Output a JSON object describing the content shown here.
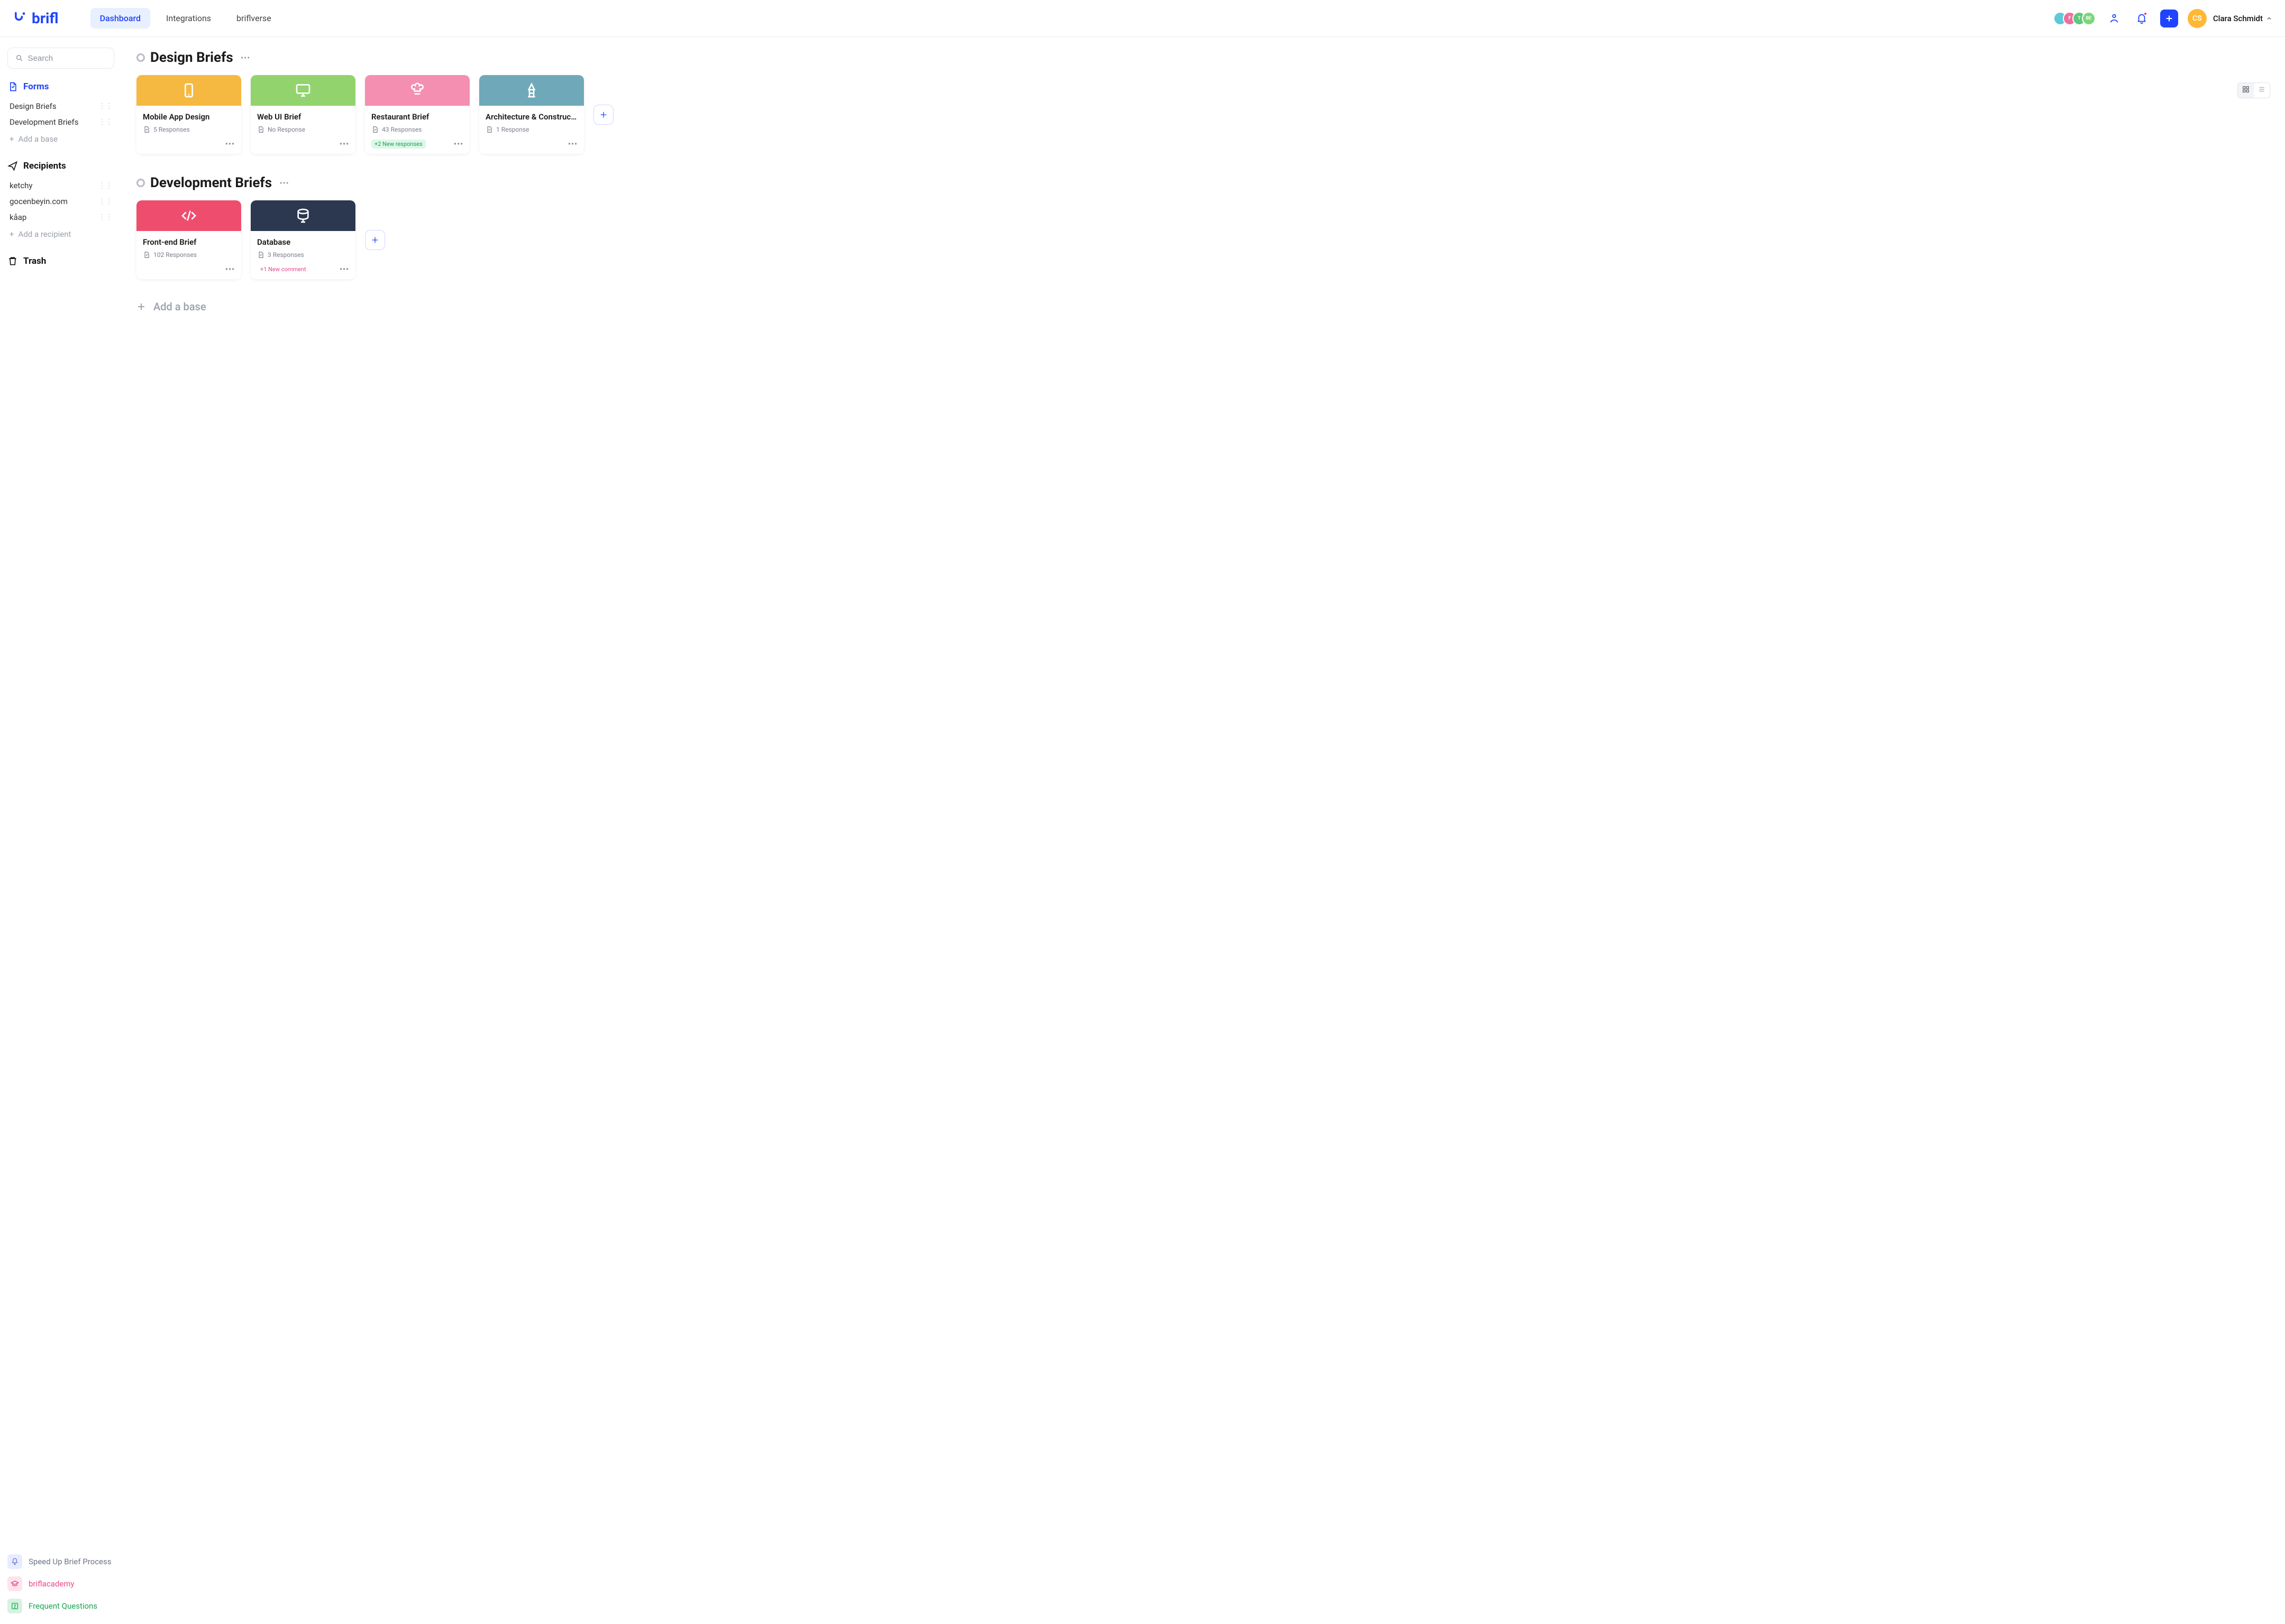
{
  "brand": "brifl",
  "nav": {
    "tabs": [
      "Dashboard",
      "Integrations",
      "briflverse"
    ],
    "active": 0
  },
  "header_avatars": [
    "",
    "F",
    "T",
    "BE"
  ],
  "user": {
    "initials": "CS",
    "name": "Clara Schmidt"
  },
  "search_placeholder": "Search",
  "sidebar": {
    "forms": {
      "title": "Forms",
      "items": [
        "Design Briefs",
        "Development Briefs"
      ],
      "add_label": "Add a base"
    },
    "recipients": {
      "title": "Recipients",
      "items": [
        "ketchy",
        "gocenbeyin.com",
        "kåap"
      ],
      "add_label": "Add a recipient"
    },
    "trash": "Trash",
    "footer": {
      "speed": "Speed Up Brief Process",
      "academy": "briflacademy",
      "faq": "Frequent Questions"
    }
  },
  "sections": [
    {
      "title": "Design Briefs",
      "cards": [
        {
          "title": "Mobile App Design",
          "meta": "5 Responses",
          "color": "c-yellow",
          "icon": "tablet",
          "badge": null,
          "badge_class": ""
        },
        {
          "title": "Web UI Brief",
          "meta": "No Response",
          "color": "c-green",
          "icon": "monitor",
          "badge": null,
          "badge_class": ""
        },
        {
          "title": "Restaurant Brief",
          "meta": "43 Responses",
          "color": "c-pink",
          "icon": "chef",
          "badge": "+2 New responses",
          "badge_class": "badge-green"
        },
        {
          "title": "Architecture & Construc...",
          "meta": "1 Response",
          "color": "c-teal",
          "icon": "tower",
          "badge": null,
          "badge_class": ""
        }
      ]
    },
    {
      "title": "Development Briefs",
      "cards": [
        {
          "title": "Front-end Brief",
          "meta": "102 Responses",
          "color": "c-red",
          "icon": "code",
          "badge": null,
          "badge_class": ""
        },
        {
          "title": "Database",
          "meta": "3 Responses",
          "color": "c-dark",
          "icon": "db",
          "badge": "+1 New comment",
          "badge_class": "badge-pink"
        }
      ]
    }
  ],
  "add_base_main": "Add a base",
  "view_toggle": {
    "grid": "grid",
    "list": "list"
  }
}
